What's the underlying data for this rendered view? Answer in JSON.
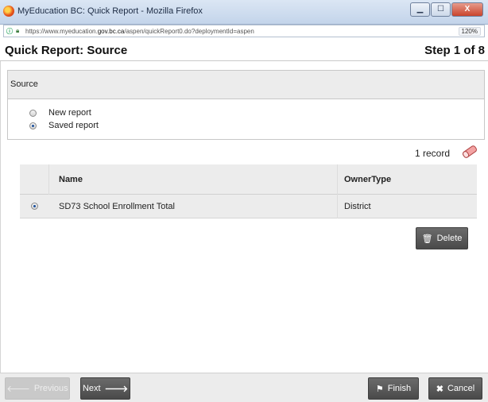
{
  "window": {
    "title": "MyEducation BC: Quick Report - Mozilla Firefox",
    "buttons": [
      "▁",
      "☐",
      "X"
    ]
  },
  "address_bar": {
    "url_prefix": "https://www.myeducation.",
    "url_domain": "gov.bc.ca",
    "url_suffix": "/aspen/quickReport0.do?deploymentId=aspen",
    "zoom": "120%"
  },
  "header": {
    "title": "Quick Report: Source",
    "step": "Step 1 of 8"
  },
  "source": {
    "heading": "Source",
    "options": [
      {
        "label": "New report",
        "selected": false
      },
      {
        "label": "Saved report",
        "selected": true
      }
    ]
  },
  "records": {
    "count": "1 record",
    "icon": "eraser-icon"
  },
  "table": {
    "columns": [
      "Name",
      "OwnerType"
    ],
    "rows": [
      {
        "name": "SD73 School Enrollment Total",
        "owner_type": "District",
        "selected": true
      }
    ]
  },
  "actions": {
    "delete": "Delete",
    "previous": "Previous",
    "next": "Next",
    "finish": "Finish",
    "cancel": "Cancel"
  }
}
